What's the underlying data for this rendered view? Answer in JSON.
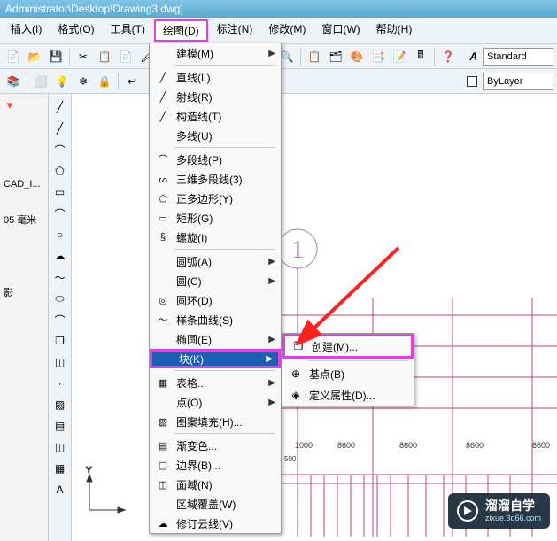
{
  "titlebar": "Administrator\\Desktop\\Drawing3.dwg]",
  "menubar": {
    "insert": "插入(I)",
    "format": "格式(O)",
    "tools": "工具(T)",
    "draw": "绘图(D)",
    "dimension": "标注(N)",
    "modify": "修改(M)",
    "window": "窗口(W)",
    "help": "帮助(H)"
  },
  "toolbar_style": {
    "style_label": "Standard",
    "layer_label": "ByLayer"
  },
  "leftpanel": {
    "items": [
      "",
      "",
      "CAD_I...",
      "",
      "05 毫米",
      "",
      "",
      "影",
      "",
      ""
    ]
  },
  "dropdown": {
    "items": [
      {
        "label": "建模(M)",
        "arrow": true
      },
      {
        "divider": true
      },
      {
        "label": "直线(L)",
        "icon": "╱"
      },
      {
        "label": "射线(R)",
        "icon": "╱"
      },
      {
        "label": "构造线(T)",
        "icon": "╱"
      },
      {
        "label": "多线(U)"
      },
      {
        "divider": true
      },
      {
        "label": "多段线(P)",
        "icon": "⌒"
      },
      {
        "label": "三维多段线(3)",
        "icon": "ᔕ"
      },
      {
        "label": "正多边形(Y)",
        "icon": "⬠"
      },
      {
        "label": "矩形(G)",
        "icon": "▭"
      },
      {
        "label": "螺旋(I)",
        "icon": "§"
      },
      {
        "divider": true
      },
      {
        "label": "圆弧(A)",
        "arrow": true
      },
      {
        "label": "圆(C)",
        "arrow": true
      },
      {
        "label": "圆环(D)",
        "icon": "◎"
      },
      {
        "label": "样条曲线(S)",
        "icon": "〜"
      },
      {
        "label": "椭圆(E)",
        "arrow": true
      },
      {
        "label": "块(K)",
        "arrow": true,
        "selected": true,
        "highlight": true
      },
      {
        "divider": true
      },
      {
        "label": "表格...",
        "icon": "▦",
        "arrow": true
      },
      {
        "label": "点(O)",
        "arrow": true
      },
      {
        "label": "图案填充(H)...",
        "icon": "▨"
      },
      {
        "divider": true
      },
      {
        "label": "渐变色...",
        "icon": "▤"
      },
      {
        "label": "边界(B)...",
        "icon": "▢"
      },
      {
        "label": "面域(N)",
        "icon": "◫"
      },
      {
        "label": "区域覆盖(W)"
      },
      {
        "label": "修订云线(V)",
        "icon": "☁"
      }
    ]
  },
  "submenu": {
    "items": [
      {
        "label": "创建(M)...",
        "icon": "❐",
        "highlight": true
      },
      {
        "divider": true
      },
      {
        "label": "基点(B)",
        "icon": "⊕"
      },
      {
        "label": "定义属性(D)...",
        "icon": "◈"
      }
    ]
  },
  "canvas": {
    "circle_number": "1",
    "dims": [
      "1000",
      "8600",
      "8600",
      "8600",
      "8600"
    ],
    "dim_small": "500"
  },
  "watermark": {
    "big": "溜溜自学",
    "small": "zixue.3d66.com"
  }
}
